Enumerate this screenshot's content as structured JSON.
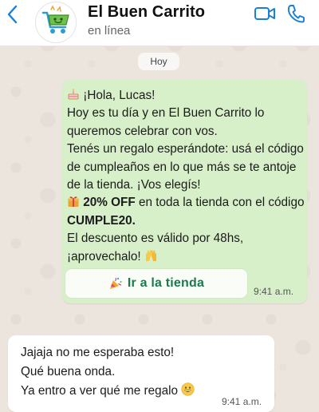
{
  "header": {
    "name": "El Buen Carrito",
    "status": "en línea"
  },
  "chat": {
    "date_label": "Hoy",
    "incoming": {
      "greeting": "¡Hola, Lucas!",
      "line2": "Hoy es tu día y en El Buen Carrito lo",
      "line3": "queremos celebrar con vos.",
      "line4": "Tenés un regalo esperándote: usá el código",
      "line5": "de cumpleaños en lo que más se te antoje",
      "line6": "de la tienda. ¡Vos elegís!",
      "discount_bold": "20% OFF",
      "discount_rest": " en toda la tienda con el código",
      "code": "CUMPLE20.",
      "line9": "El descuento es válido por 48hs,",
      "line10": "¡aprovechalo!",
      "cta_label": "Ir a la tienda",
      "time": "9:41 a.m."
    },
    "reply": {
      "line1": "Jajaja no me esperaba esto!",
      "line2": "Qué buena onda.",
      "line3": "Ya entro a ver qué me regalo",
      "time": "9:41 a.m."
    }
  },
  "icons": {
    "back": "chevron-left-icon",
    "video": "video-camera-icon",
    "call": "phone-icon",
    "cake": "birthday-cake-icon",
    "gift": "gift-icon",
    "hands": "raising-hands-icon",
    "party": "party-popper-icon",
    "grin": "grinning-face-icon"
  },
  "colors": {
    "accent": "#1a7fd6",
    "incoming_bubble": "#d8f0c9",
    "cta_text": "#1a7a4c",
    "brand_green": "#6cc24a"
  }
}
